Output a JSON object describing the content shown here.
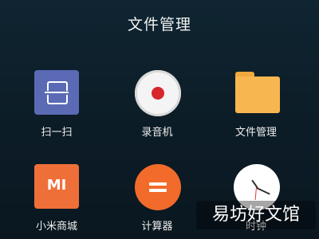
{
  "folder": {
    "title": "文件管理"
  },
  "apps": [
    {
      "label": "扫一扫",
      "icon": "scan-icon",
      "color": "#5a6ab5"
    },
    {
      "label": "录音机",
      "icon": "recorder-icon",
      "color": "#f4f4f4"
    },
    {
      "label": "文件管理",
      "icon": "folder-icon",
      "color": "#f7b650"
    },
    {
      "label": "小米商城",
      "icon": "mi-store-icon",
      "color": "#ef6f39",
      "icon_text": "MI"
    },
    {
      "label": "计算器",
      "icon": "calculator-icon",
      "color": "#f26b2b"
    },
    {
      "label": "时钟",
      "icon": "clock-icon",
      "color": "#ffffff"
    }
  ],
  "watermark": {
    "text": "易坊好文馆"
  },
  "colors": {
    "background": "#0d1e28",
    "accent_red": "#d8262d"
  }
}
